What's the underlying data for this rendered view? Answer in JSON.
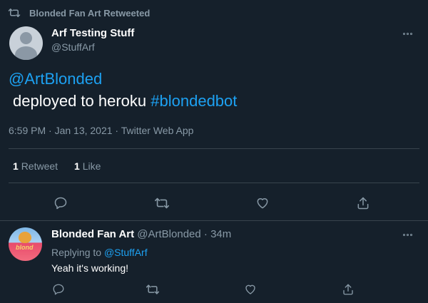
{
  "retweet_banner": {
    "text": "Blonded Fan Art Retweeted",
    "icon": "retweet-icon"
  },
  "main_tweet": {
    "author_name": "Arf Testing Stuff",
    "author_handle": "@StuffArf",
    "mention": "@ArtBlonded",
    "body_text": "deployed to heroku",
    "hashtag": "#blondedbot",
    "timestamp": "6:59 PM · Jan 13, 2021 · Twitter Web App",
    "retweet_count": "1",
    "retweet_label": "Retweet",
    "like_count": "1",
    "like_label": "Like"
  },
  "reply": {
    "author_name": "Blonded Fan Art",
    "author_handle": "@ArtBlonded",
    "age": "· 34m",
    "replying_prefix": "Replying to",
    "replying_to": "@StuffArf",
    "text": "Yeah it's working!",
    "avatar_text": "blond"
  },
  "colors": {
    "background": "#15202b",
    "accent": "#1da1f2",
    "muted": "#8899a6",
    "divider": "#38444d"
  }
}
